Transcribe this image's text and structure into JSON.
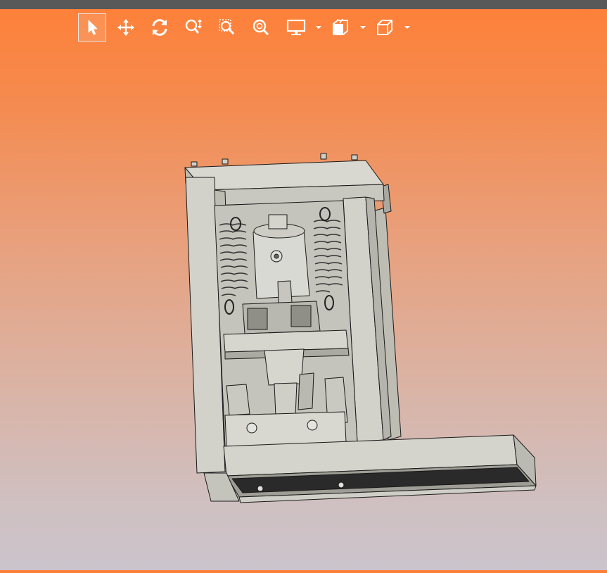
{
  "window": {
    "title_bar_color": "#595959",
    "background_top": "#fe8038",
    "background_bottom": "#cbc4cc"
  },
  "toolbar": {
    "buttons": [
      {
        "icon": "select-pointer-icon",
        "active": true
      },
      {
        "icon": "pan-move-icon",
        "active": false
      },
      {
        "icon": "rotate-icon",
        "active": false
      },
      {
        "icon": "zoom-in-out-icon",
        "active": false
      },
      {
        "icon": "zoom-window-icon",
        "active": false
      },
      {
        "icon": "zoom-fit-icon",
        "active": false
      },
      {
        "icon": "display-mode-icon",
        "has_dropdown": true
      },
      {
        "icon": "section-view-icon",
        "has_dropdown": true
      },
      {
        "icon": "view-orientation-cube-icon",
        "has_dropdown": true
      }
    ],
    "icon_color": "#ffffff"
  },
  "model": {
    "description_icon": "cad-assembly-press-frame",
    "body_color": "#cfcfc7",
    "outline_color": "#1a1a1a"
  }
}
